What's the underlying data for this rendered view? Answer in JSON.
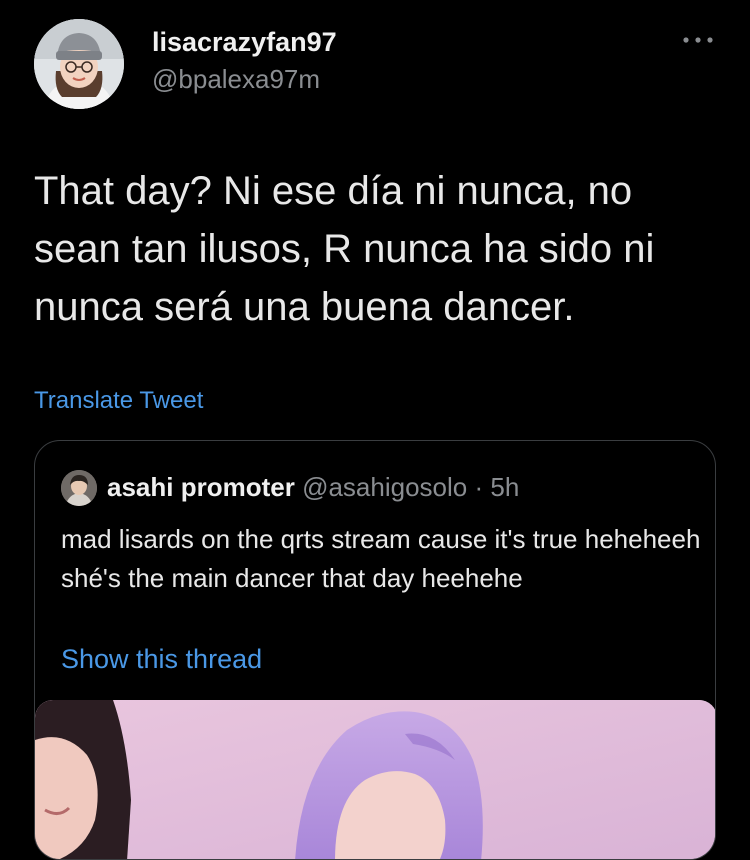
{
  "tweet": {
    "author": {
      "display_name": "lisacrazyfan97",
      "handle": "@bpalexa97m",
      "avatar_icon": "profile-photo"
    },
    "more_icon": "more-dots-icon",
    "text": "That day? Ni ese día ni nunca, no sean tan ilusos, R nunca ha sido ni nunca será una buena dancer.",
    "translate_label": "Translate Tweet"
  },
  "quoted_tweet": {
    "display_name": "asahi promoter",
    "handle": "@asahigosolo",
    "separator": "·",
    "time": "5h",
    "text": "mad lisards on the qrts stream cause it's true heheheeh shé's the main dancer that day heehehe",
    "show_thread_label": "Show this thread",
    "media": "video-thumbnail"
  },
  "colors": {
    "background": "#000000",
    "link": "#4a98e6",
    "secondary_text": "#8a8d91",
    "border": "#3a3d40"
  }
}
